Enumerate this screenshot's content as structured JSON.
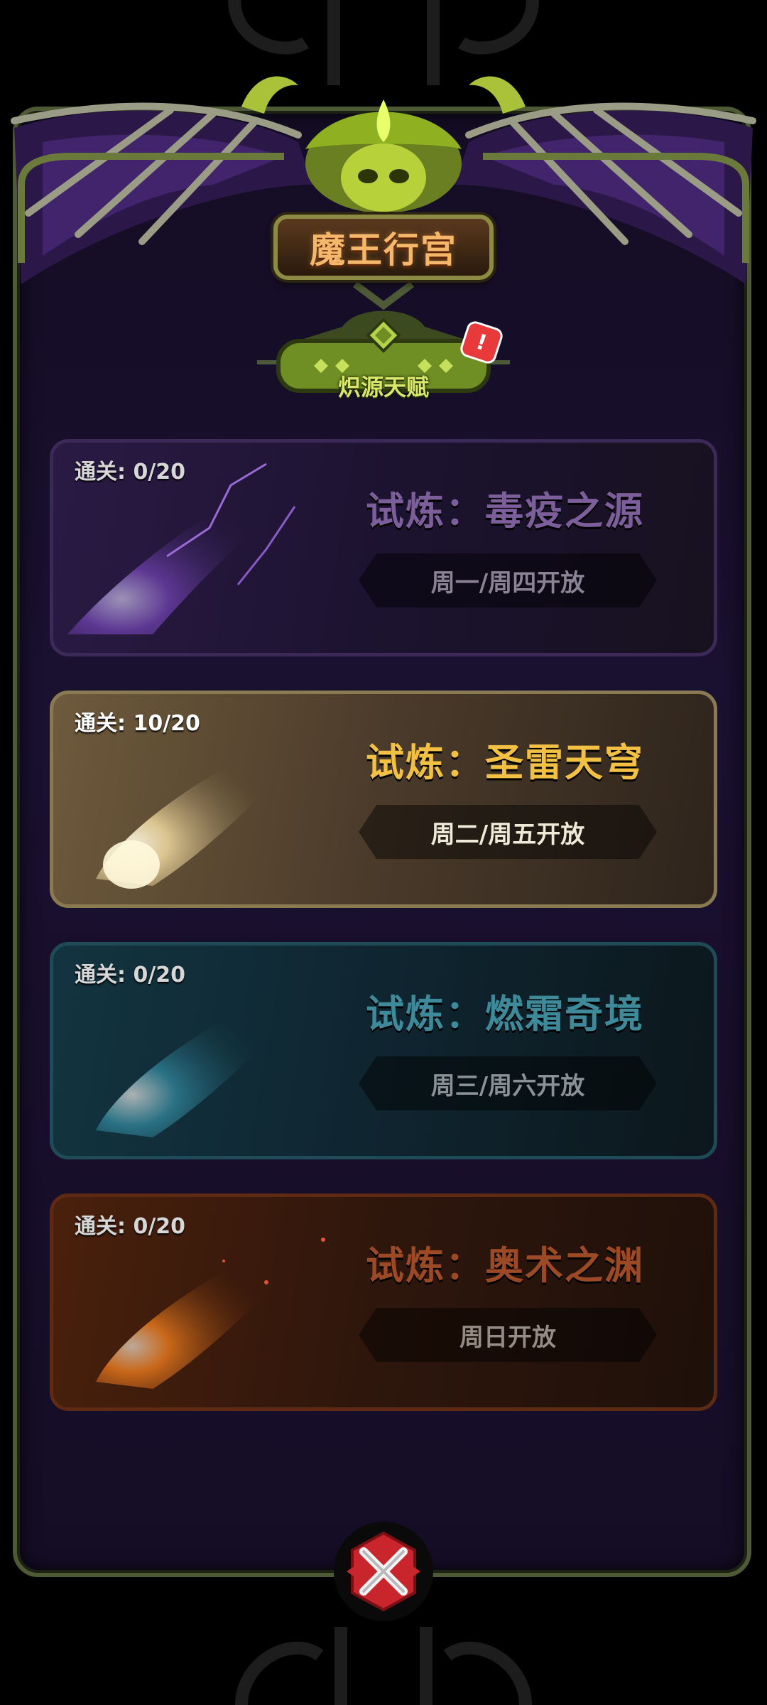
{
  "header": {
    "title": "魔王行宫"
  },
  "talent": {
    "label": "炽源天赋",
    "has_alert": true,
    "alert_glyph": "!"
  },
  "trials": [
    {
      "progress": "通关: 0/20",
      "title": "试炼：毒疫之源",
      "schedule": "周一/周四开放",
      "theme": "purple",
      "active": false,
      "title_color": "#7b5e9a",
      "schedule_color": "#8a8396"
    },
    {
      "progress": "通关: 10/20",
      "title": "试炼：圣雷天穹",
      "schedule": "周二/周五开放",
      "theme": "gold",
      "active": true,
      "title_color": "#f2c043",
      "schedule_color": "#efe9d8"
    },
    {
      "progress": "通关: 0/20",
      "title": "试炼：燃霜奇境",
      "schedule": "周三/周六开放",
      "theme": "teal",
      "active": false,
      "title_color": "#3f8a9a",
      "schedule_color": "#8a9296"
    },
    {
      "progress": "通关: 0/20",
      "title": "试炼：奥术之渊",
      "schedule": "周日开放",
      "theme": "orange",
      "active": false,
      "title_color": "#9c4a26",
      "schedule_color": "#968c86"
    }
  ],
  "close_button": {
    "icon": "close-icon"
  }
}
